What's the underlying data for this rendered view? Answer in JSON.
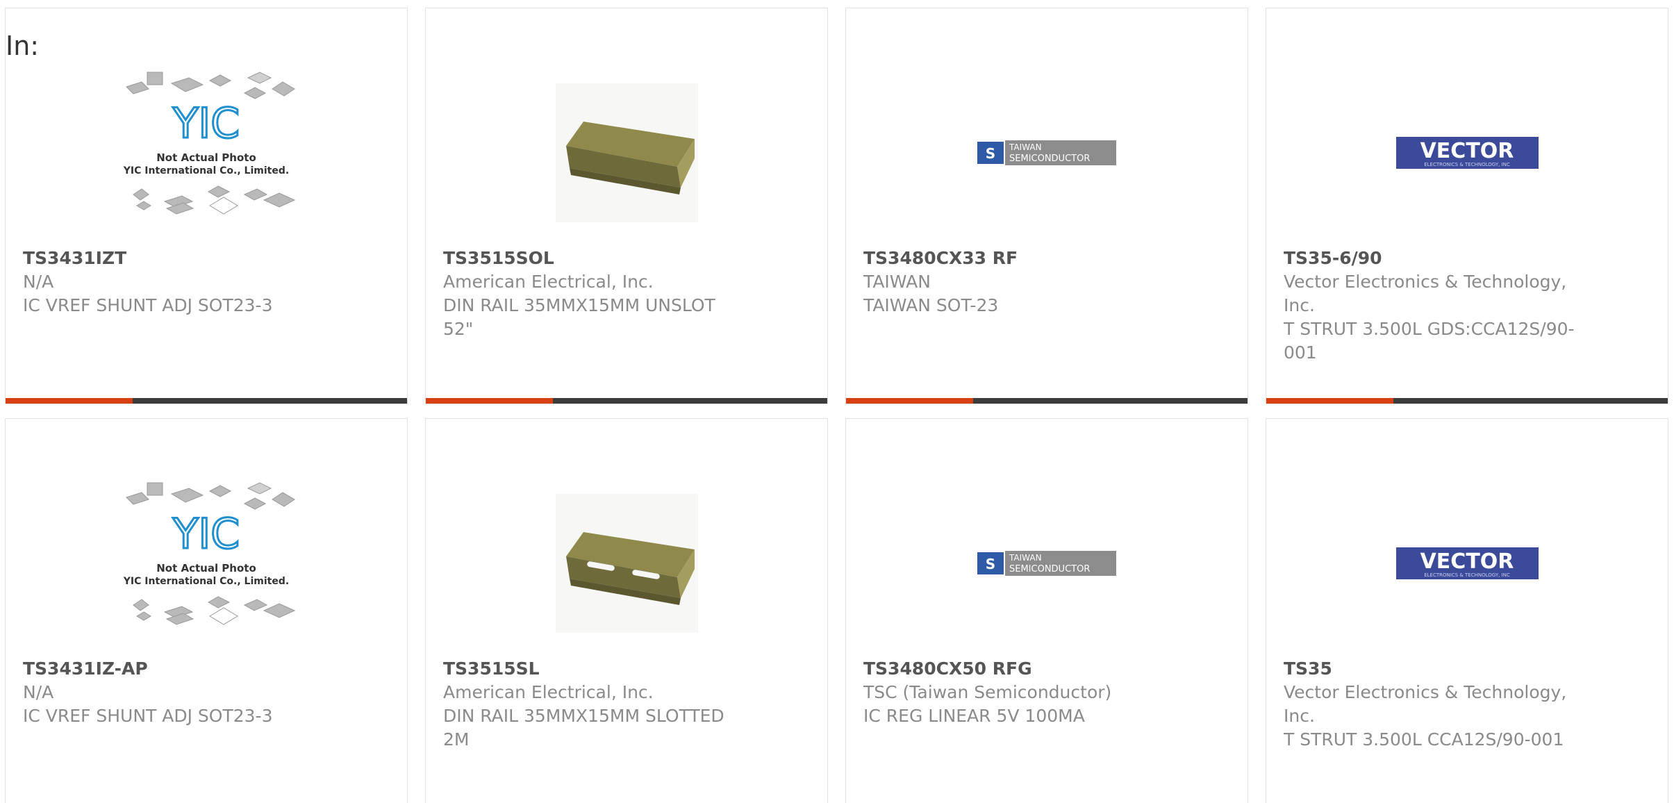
{
  "page": {
    "filter_label": "In:"
  },
  "products": [
    {
      "part_number": "TS3431IZT",
      "manufacturer": "N/A",
      "description": "IC VREF SHUNT ADJ SOT23-3",
      "image": "yic-placeholder",
      "image_caption_1": "Not Actual Photo",
      "image_caption_2": "YIC International Co., Limited."
    },
    {
      "part_number": "TS3515SOL",
      "manufacturer": "American Electrical, Inc.",
      "description": "DIN RAIL 35MMX15MM UNSLOT 52\"",
      "image": "din-rail-unslotted"
    },
    {
      "part_number": "TS3480CX33 RF",
      "manufacturer": "TAIWAN",
      "description": "TAIWAN SOT-23",
      "image": "taiwan-semiconductor-logo",
      "logo_text_1": "TAIWAN",
      "logo_text_2": "SEMICONDUCTOR"
    },
    {
      "part_number": "TS35-6/90",
      "manufacturer": "Vector Electronics & Technology, Inc.",
      "description": "T STRUT 3.500L GDS:CCA12S/90-001",
      "image": "vector-logo",
      "logo_text_1": "VECTOR",
      "logo_text_2": "ELECTRONICS & TECHNOLOGY, INC"
    },
    {
      "part_number": "TS3431IZ-AP",
      "manufacturer": "N/A",
      "description": "IC VREF SHUNT ADJ SOT23-3",
      "image": "yic-placeholder",
      "image_caption_1": "Not Actual Photo",
      "image_caption_2": "YIC International Co., Limited."
    },
    {
      "part_number": "TS3515SL",
      "manufacturer": "American Electrical, Inc.",
      "description": "DIN RAIL 35MMX15MM SLOTTED 2M",
      "image": "din-rail-slotted"
    },
    {
      "part_number": "TS3480CX50 RFG",
      "manufacturer": "TSC (Taiwan Semiconductor)",
      "description": "IC REG LINEAR 5V 100MA",
      "image": "taiwan-semiconductor-logo",
      "logo_text_1": "TAIWAN",
      "logo_text_2": "SEMICONDUCTOR"
    },
    {
      "part_number": "TS35",
      "manufacturer": "Vector Electronics & Technology, Inc.",
      "description": "T STRUT 3.500L CCA12S/90-001",
      "image": "vector-logo",
      "logo_text_1": "VECTOR",
      "logo_text_2": "ELECTRONICS & TECHNOLOGY, INC"
    }
  ],
  "colors": {
    "accent": "#d8410f",
    "bar_dark": "#3c3c3c",
    "part_number": "#555555",
    "text_muted": "#8a8a8a",
    "border": "#e2e2e2",
    "tsc_logo_bg": "#8c8c8c",
    "tsc_logo_blue": "#2e5aa8",
    "vector_blue": "#3c4a9a",
    "yic_blue": "#1f8fd0"
  }
}
